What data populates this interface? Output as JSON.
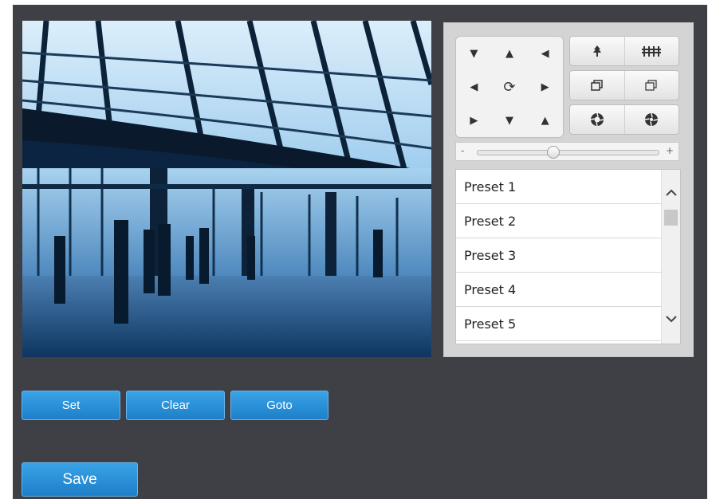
{
  "ptz": {
    "direction_pad": {
      "up_left": "▼",
      "up": "▲",
      "up_right": "◀",
      "left": "◀",
      "center": "⟳",
      "right": "▶",
      "down_left": "▶",
      "down": "▼",
      "down_right": "▲"
    },
    "zoom_in_icon": "zoom-in-tree-icon",
    "zoom_out_icon": "zoom-out-trees-icon",
    "focus_near_icon": "focus-near-icon",
    "focus_far_icon": "focus-far-icon",
    "iris_open_icon": "iris-open-icon",
    "iris_close_icon": "iris-close-icon",
    "speed_slider": {
      "minus": "-",
      "plus": "+",
      "value_fraction": 0.42
    }
  },
  "presets": {
    "items": [
      "Preset 1",
      "Preset 2",
      "Preset 3",
      "Preset 4",
      "Preset 5"
    ],
    "scroll_up": "^",
    "scroll_down": "v"
  },
  "actions": {
    "set_label": "Set",
    "clear_label": "Clear",
    "goto_label": "Goto",
    "save_label": "Save"
  },
  "colors": {
    "background": "#3f4045",
    "button_blue": "#2590d8",
    "panel": "#d4d4d4"
  }
}
